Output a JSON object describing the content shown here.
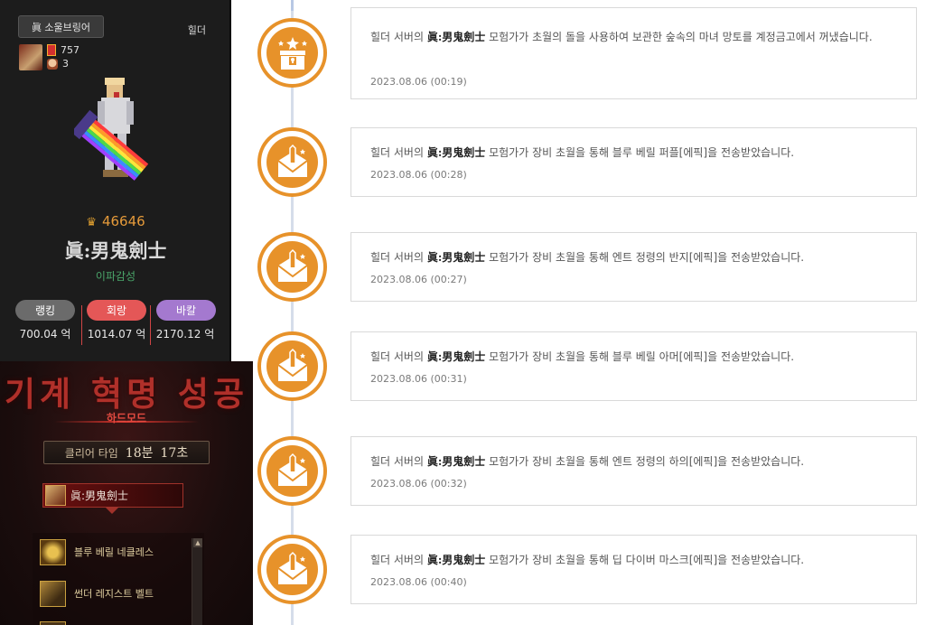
{
  "character_card": {
    "title_button": "眞 소울브링어",
    "server": "힐더",
    "stat1": "757",
    "stat2": "3",
    "fame": "46646",
    "name": "眞:男鬼劍士",
    "guild": "이파감성",
    "stats": [
      {
        "label": "랭킹",
        "amount": "700.04 억",
        "color": "#6b6b6b"
      },
      {
        "label": "회랑",
        "amount": "1014.07 억",
        "color": "#e45757"
      },
      {
        "label": "바칼",
        "amount": "2170.12 억",
        "color": "#a479cf"
      }
    ]
  },
  "raid_clear": {
    "title": "기계 혁명 성공",
    "mode": "하드모드",
    "clear_label": "클리어 타임",
    "minutes": "18분",
    "seconds": "17초",
    "player_name": "眞:男鬼劍士",
    "items": [
      "블루 베릴 네클레스",
      "썬더 레지스트 벨트"
    ]
  },
  "timeline": {
    "accent_color": "#e7922a",
    "entries": [
      {
        "icon": "treasure-chest-icon",
        "prefix": "힐더 서버의 ",
        "name": "眞:男鬼劍士",
        "suffix": " 모험가가 초월의 돌을 사용하여 보관한 숲속의 마녀 망토를 계정금고에서 꺼냈습니다.",
        "date": "2023.08.06 (00:19)"
      },
      {
        "icon": "envelope-sword-icon",
        "prefix": "힐더 서버의 ",
        "name": "眞:男鬼劍士",
        "suffix": " 모험가가 장비 초월을 통해 블루 베릴 퍼플[에픽]을 전송받았습니다.",
        "date": "2023.08.06 (00:28)"
      },
      {
        "icon": "envelope-sword-icon",
        "prefix": "힐더 서버의 ",
        "name": "眞:男鬼劍士",
        "suffix": " 모험가가 장비 초월을 통해 엔트 정령의 반지[에픽]을 전송받았습니다.",
        "date": "2023.08.06 (00:27)"
      },
      {
        "icon": "envelope-sword-icon",
        "prefix": "힐더 서버의 ",
        "name": "眞:男鬼劍士",
        "suffix": " 모험가가 장비 초월을 통해 블루 베릴 아머[에픽]을 전송받았습니다.",
        "date": "2023.08.06 (00:31)"
      },
      {
        "icon": "envelope-sword-icon",
        "prefix": "힐더 서버의 ",
        "name": "眞:男鬼劍士",
        "suffix": " 모험가가 장비 초월을 통해 엔트 정령의 하의[에픽]을 전송받았습니다.",
        "date": "2023.08.06 (00:32)"
      },
      {
        "icon": "envelope-sword-icon",
        "prefix": "힐더 서버의 ",
        "name": "眞:男鬼劍士",
        "suffix": " 모험가가 장비 초월을 통해 딥 다이버 마스크[에픽]을 전송받았습니다.",
        "date": "2023.08.06 (00:40)"
      }
    ]
  }
}
